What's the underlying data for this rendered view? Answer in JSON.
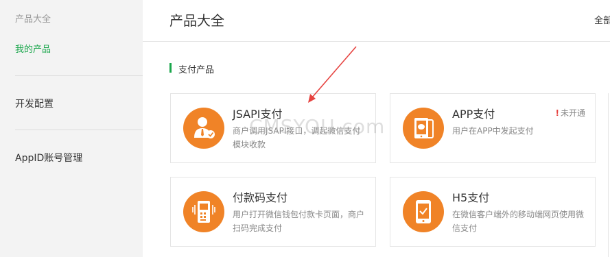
{
  "sidebar": {
    "sub_items": [
      "产品大全",
      "我的产品"
    ],
    "items": [
      "开发配置",
      "AppID账号管理"
    ]
  },
  "header": {
    "title": "产品大全",
    "filter_label": "全部"
  },
  "section": {
    "title": "支付产品"
  },
  "products": [
    {
      "name": "JSAPI支付",
      "desc": "商户调用JSAPI接口，调起微信支付模块收款",
      "status": "",
      "icon": "user-check-icon"
    },
    {
      "name": "APP支付",
      "desc": "用户在APP中发起支付",
      "status": "未开通",
      "icon": "phone-app-icon"
    },
    {
      "name": "付款码支付",
      "desc": "用户打开微信钱包付款卡页面，商户扫码完成支付",
      "status": "",
      "icon": "scanner-icon"
    },
    {
      "name": "H5支付",
      "desc": "在微信客户端外的移动端网页使用微信支付",
      "status": "",
      "icon": "phone-check-icon"
    }
  ],
  "watermark": "CMSYOU.com",
  "colors": {
    "accent_green": "#19a64b",
    "icon_orange": "#f08327",
    "annotation_red": "#e64340",
    "sidebar_bg": "#f3f3f3"
  }
}
